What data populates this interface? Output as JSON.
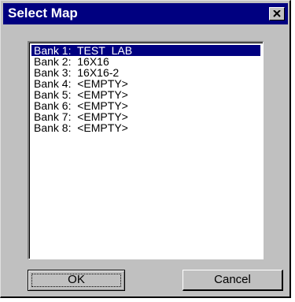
{
  "window": {
    "title": "Select Map",
    "close_icon": "close-icon"
  },
  "listbox": {
    "items": [
      "Bank 1:  TEST_LAB",
      "Bank 2:  16X16",
      "Bank 3:  16X16-2",
      "Bank 4:  <EMPTY>",
      "Bank 5:  <EMPTY>",
      "Bank 6:  <EMPTY>",
      "Bank 7:  <EMPTY>",
      "Bank 8:  <EMPTY>"
    ],
    "selected_index": 0
  },
  "buttons": {
    "ok_label": "OK",
    "cancel_label": "Cancel"
  },
  "colors": {
    "titlebar": "#000080",
    "face": "#c0c0c0",
    "selection": "#000080"
  }
}
